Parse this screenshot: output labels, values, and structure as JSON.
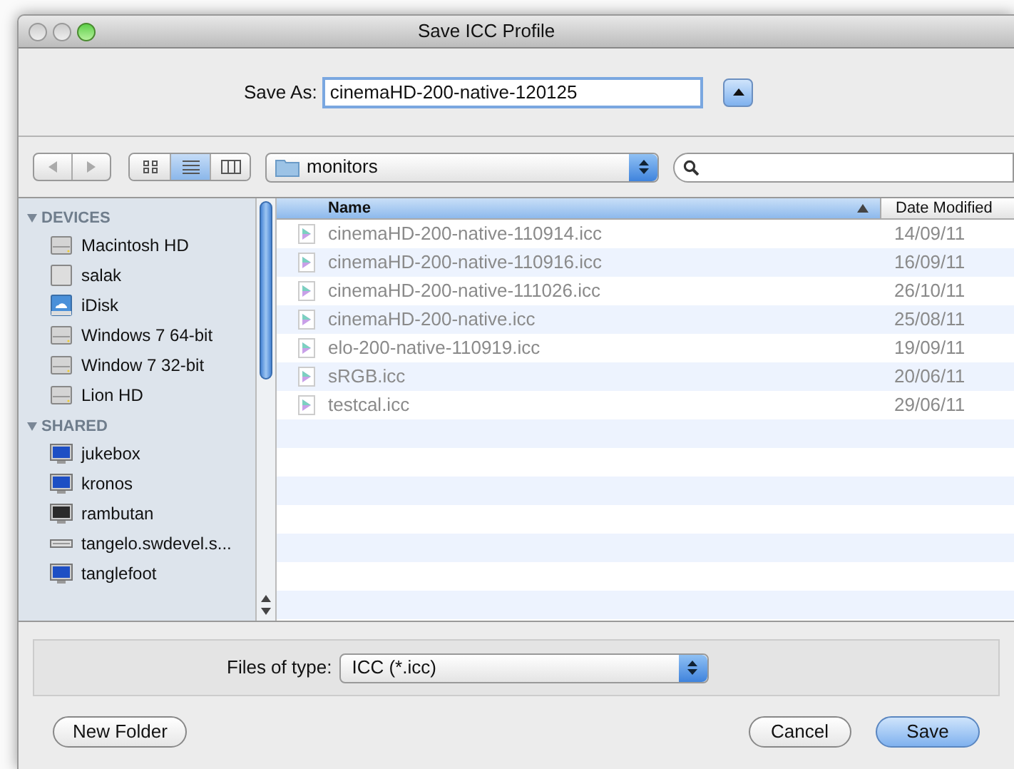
{
  "window": {
    "title": "Save ICC Profile"
  },
  "save_as": {
    "label": "Save As:",
    "value": "cinemaHD-200-native-120125"
  },
  "view_modes": [
    {
      "kind": "icons",
      "selected": false
    },
    {
      "kind": "list",
      "selected": true
    },
    {
      "kind": "columns",
      "selected": false
    }
  ],
  "location": {
    "value": "monitors"
  },
  "sidebar": {
    "sections": [
      {
        "title": "DEVICES",
        "expanded": true,
        "items": [
          {
            "label": "Macintosh HD",
            "kind": "drive"
          },
          {
            "label": "salak",
            "kind": "computer"
          },
          {
            "label": "iDisk",
            "kind": "idisk"
          },
          {
            "label": "Windows 7 64-bit",
            "kind": "drive"
          },
          {
            "label": "Window 7 32-bit",
            "kind": "drive"
          },
          {
            "label": "Lion HD",
            "kind": "drive"
          }
        ]
      },
      {
        "title": "SHARED",
        "expanded": true,
        "items": [
          {
            "label": "jukebox",
            "kind": "display"
          },
          {
            "label": "kronos",
            "kind": "display"
          },
          {
            "label": "rambutan",
            "kind": "screen"
          },
          {
            "label": "tangelo.swdevel.s...",
            "kind": "server"
          },
          {
            "label": "tanglefoot",
            "kind": "display"
          }
        ]
      }
    ]
  },
  "table": {
    "columns": [
      {
        "label": "Name",
        "sorted": true
      },
      {
        "label": "Date Modified",
        "sorted": false
      }
    ],
    "rows": [
      {
        "name": "cinemaHD-200-native-110914.icc",
        "date": "14/09/11",
        "disabled": true
      },
      {
        "name": "cinemaHD-200-native-110916.icc",
        "date": "16/09/11",
        "disabled": true
      },
      {
        "name": "cinemaHD-200-native-111026.icc",
        "date": "26/10/11",
        "disabled": true
      },
      {
        "name": "cinemaHD-200-native.icc",
        "date": "25/08/11",
        "disabled": true
      },
      {
        "name": "elo-200-native-110919.icc",
        "date": "19/09/11",
        "disabled": true
      },
      {
        "name": "sRGB.icc",
        "date": "20/06/11",
        "disabled": true
      },
      {
        "name": "testcal.icc",
        "date": "29/06/11",
        "disabled": true
      }
    ]
  },
  "file_type": {
    "label": "Files of type:",
    "value": "ICC (*.icc)"
  },
  "buttons": [
    {
      "label": "New Folder",
      "kind": "plain"
    },
    {
      "label": "Cancel",
      "kind": "plain"
    },
    {
      "label": "Save",
      "kind": "default"
    }
  ]
}
